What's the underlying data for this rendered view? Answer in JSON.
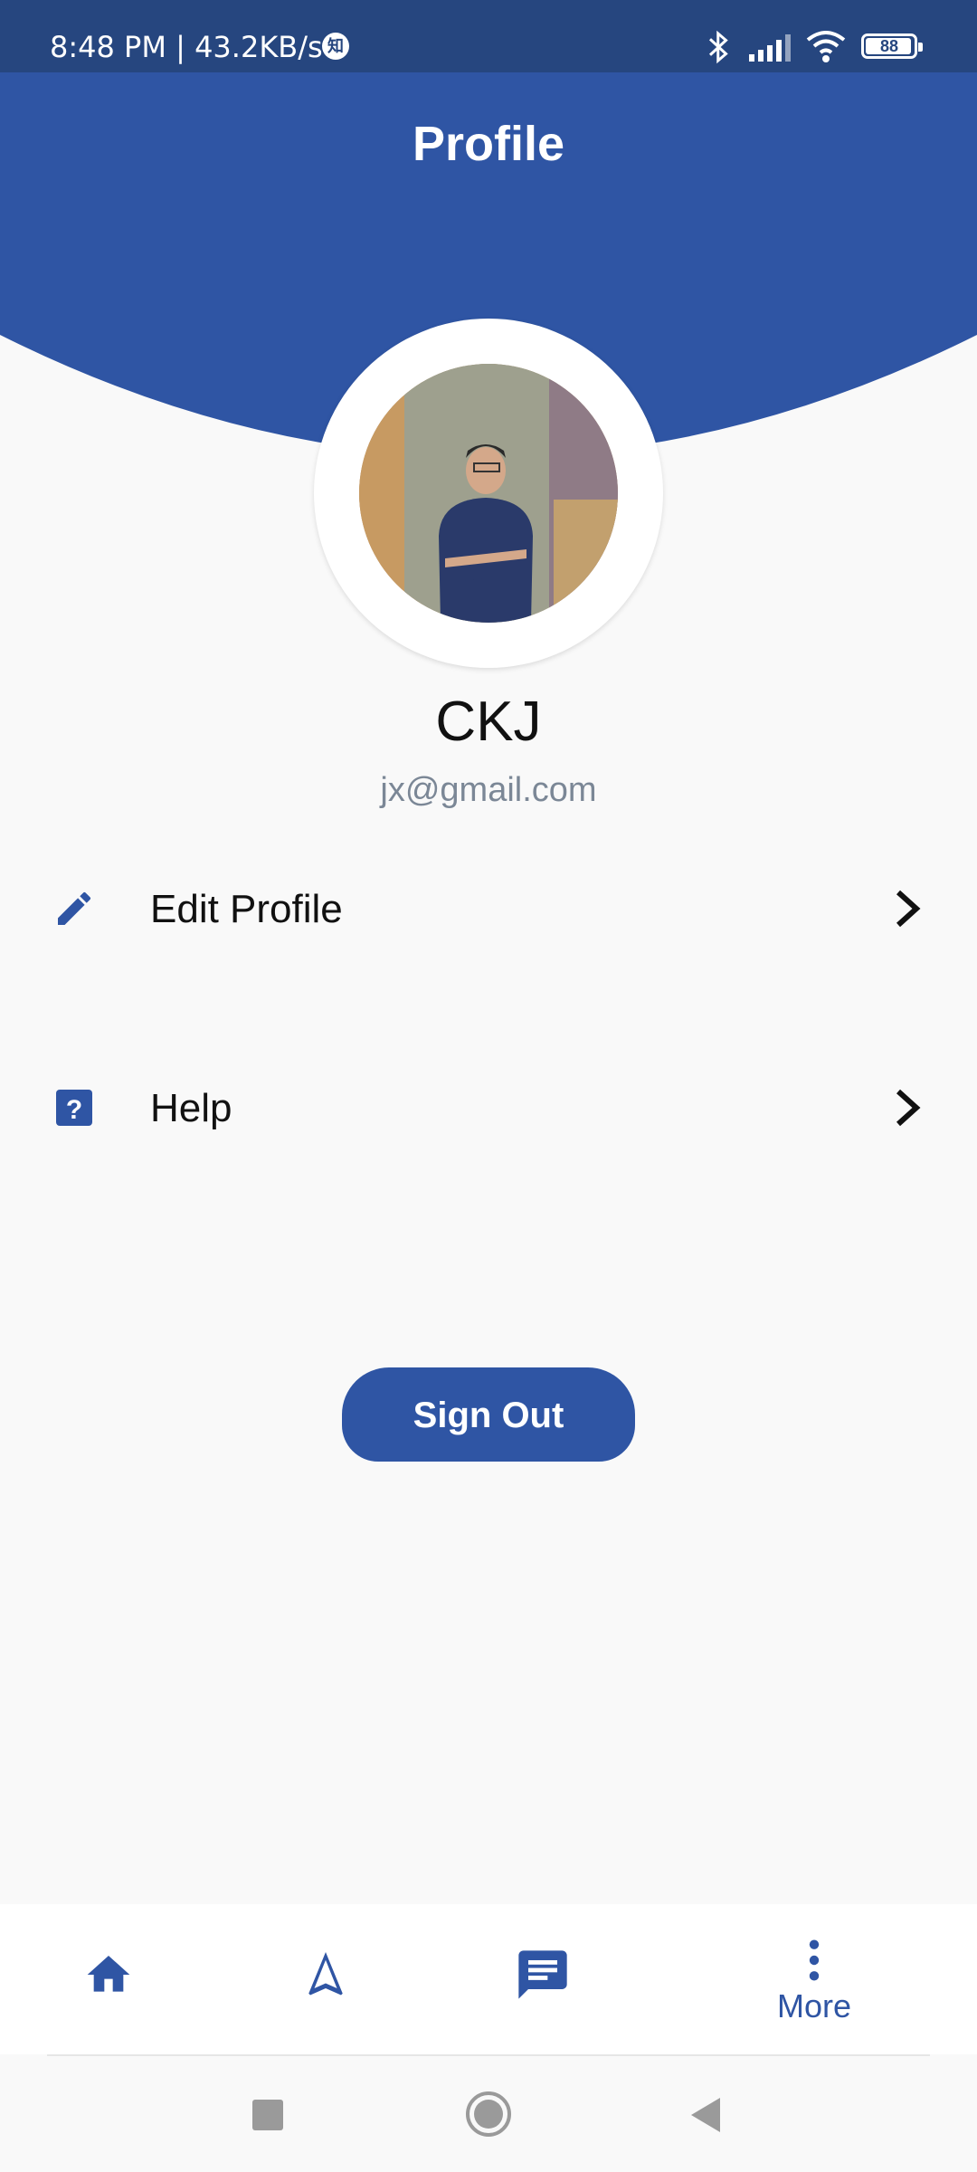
{
  "status_bar": {
    "time_speed": "8:48 PM | 43.2KB/s",
    "app_badge": "知",
    "battery": "88"
  },
  "header": {
    "title": "Profile",
    "color": "#2f55a4"
  },
  "profile": {
    "name": "CKJ",
    "email": "jx@gmail.com"
  },
  "menu": [
    {
      "label": "Edit Profile",
      "icon": "pencil-icon"
    },
    {
      "label": "Help",
      "icon": "help-icon"
    }
  ],
  "sign_out": {
    "label": "Sign Out"
  },
  "bottom_nav": {
    "items": [
      {
        "icon": "home-icon"
      },
      {
        "icon": "navigation-icon"
      },
      {
        "icon": "message-icon"
      },
      {
        "icon": "more-vert-icon",
        "label": "More"
      }
    ]
  },
  "system_nav": [
    "square-icon",
    "circle-icon",
    "back-triangle-icon"
  ]
}
